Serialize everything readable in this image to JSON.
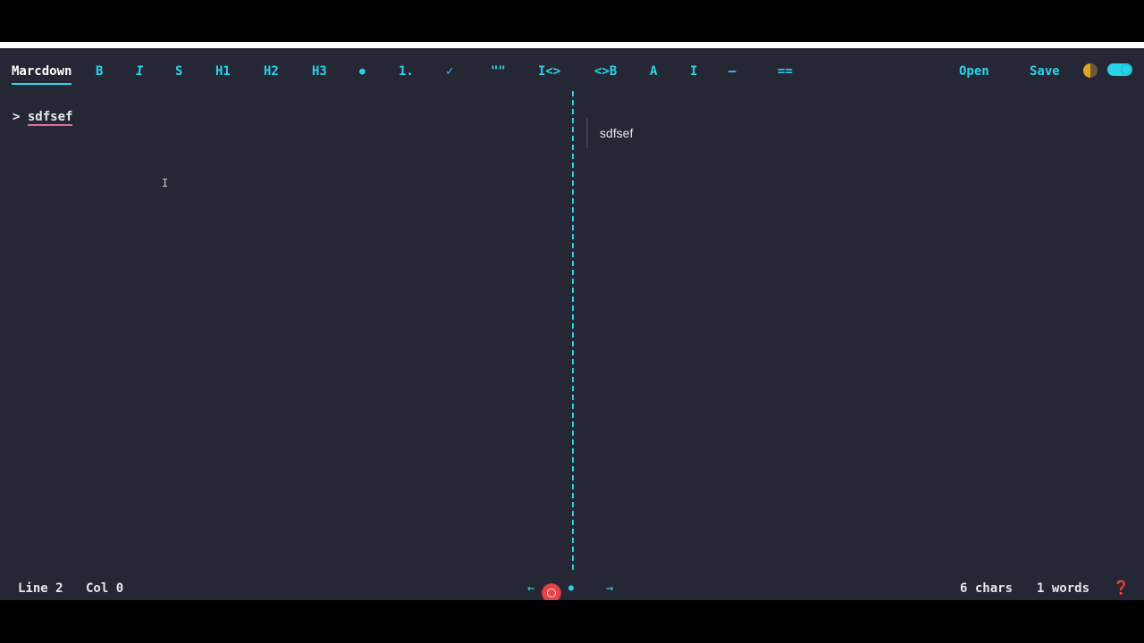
{
  "toolbar": {
    "brand": "Marcdown",
    "bold": "B",
    "italic": "I",
    "strike": "S",
    "h1": "H1",
    "h2": "H2",
    "h3": "H3",
    "bullet_list": "●",
    "numbered_list": "1.",
    "task_list": "✓",
    "quote": "\"\"",
    "code_inline_left": "I<>",
    "code_block": "<>B",
    "link": "A",
    "image": "I",
    "hr": "—",
    "table": "==",
    "open": "Open",
    "save": "Save"
  },
  "editor": {
    "prefix": "> ",
    "text": "sdfsef"
  },
  "preview": {
    "quote_text": "sdfsef"
  },
  "status": {
    "line": "Line 2",
    "col": "Col 0",
    "prev": "←",
    "center": "●",
    "next": "→",
    "chars": "6 chars",
    "words": "1 words",
    "help": "❓"
  },
  "icons": {
    "theme": "half-moon-icon",
    "toggle": "preview-toggle",
    "record": "record-icon"
  },
  "colors": {
    "accent": "#29d3ea",
    "background": "#252834",
    "text": "#e8e8ea",
    "typo_underline": "#e36aa8"
  }
}
